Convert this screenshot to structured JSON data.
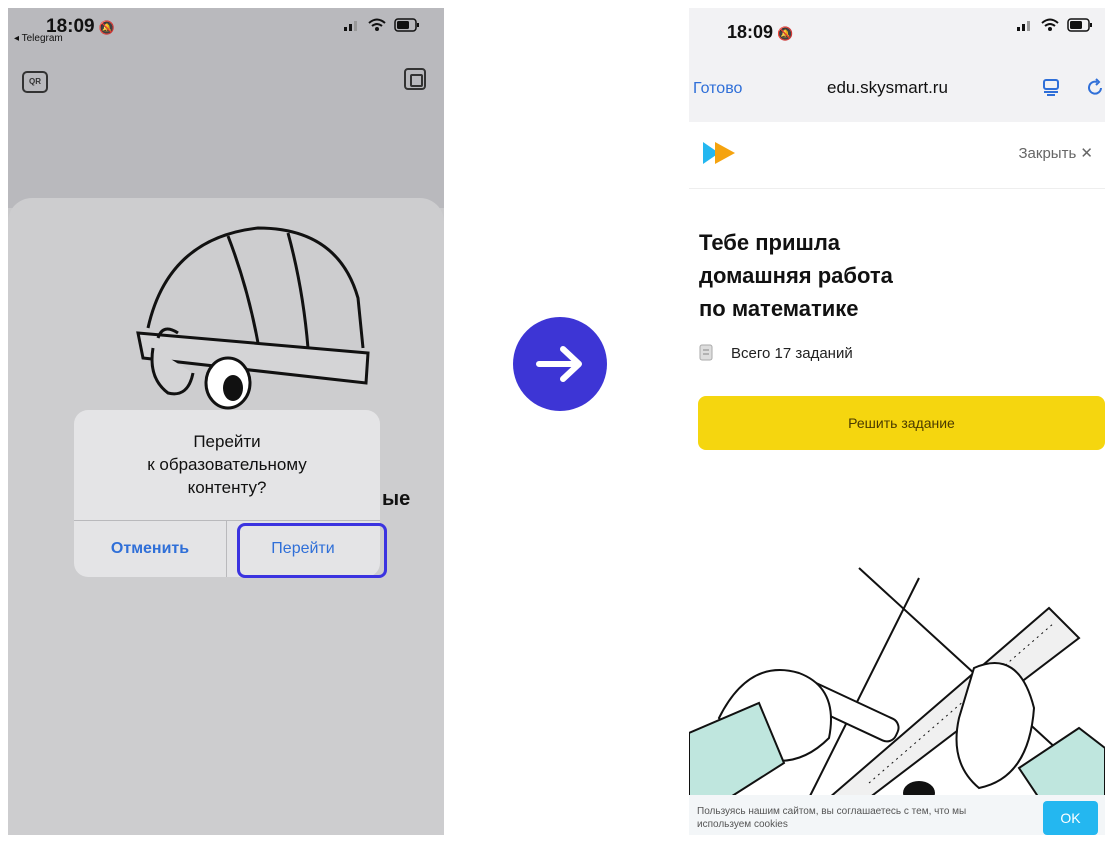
{
  "left_phone": {
    "status": {
      "time": "18:09",
      "back_app": "◂ Telegram"
    },
    "partial_text": "ые",
    "alert": {
      "message_line1": "Перейти",
      "message_line2": "к образовательному",
      "message_line3": "контенту?",
      "cancel_label": "Отменить",
      "go_label": "Перейти"
    }
  },
  "right_phone": {
    "status": {
      "time": "18:09"
    },
    "browser": {
      "done_label": "Готово",
      "url": "edu.skysmart.ru"
    },
    "close_label": "Закрыть ✕",
    "headline_line1": "Тебе пришла",
    "headline_line2": "домашняя работа",
    "headline_line3": "по математике",
    "tasks_label": "Всего 17 заданий",
    "cta_label": "Решить задание",
    "cookie": {
      "text": "Пользуясь нашим сайтом, вы соглашаетесь с тем, что мы используем cookies",
      "ok_label": "OK"
    }
  },
  "colors": {
    "accent": "#3d35d5",
    "link": "#2f6fd8",
    "cta": "#f5d60f",
    "ok": "#24b7f0"
  },
  "icons": [
    "bell-icon",
    "signal-icon",
    "wifi-icon",
    "battery-icon",
    "qr-icon",
    "share-icon",
    "tabs-icon",
    "reload-icon",
    "arrow-right-icon",
    "task-icon"
  ]
}
